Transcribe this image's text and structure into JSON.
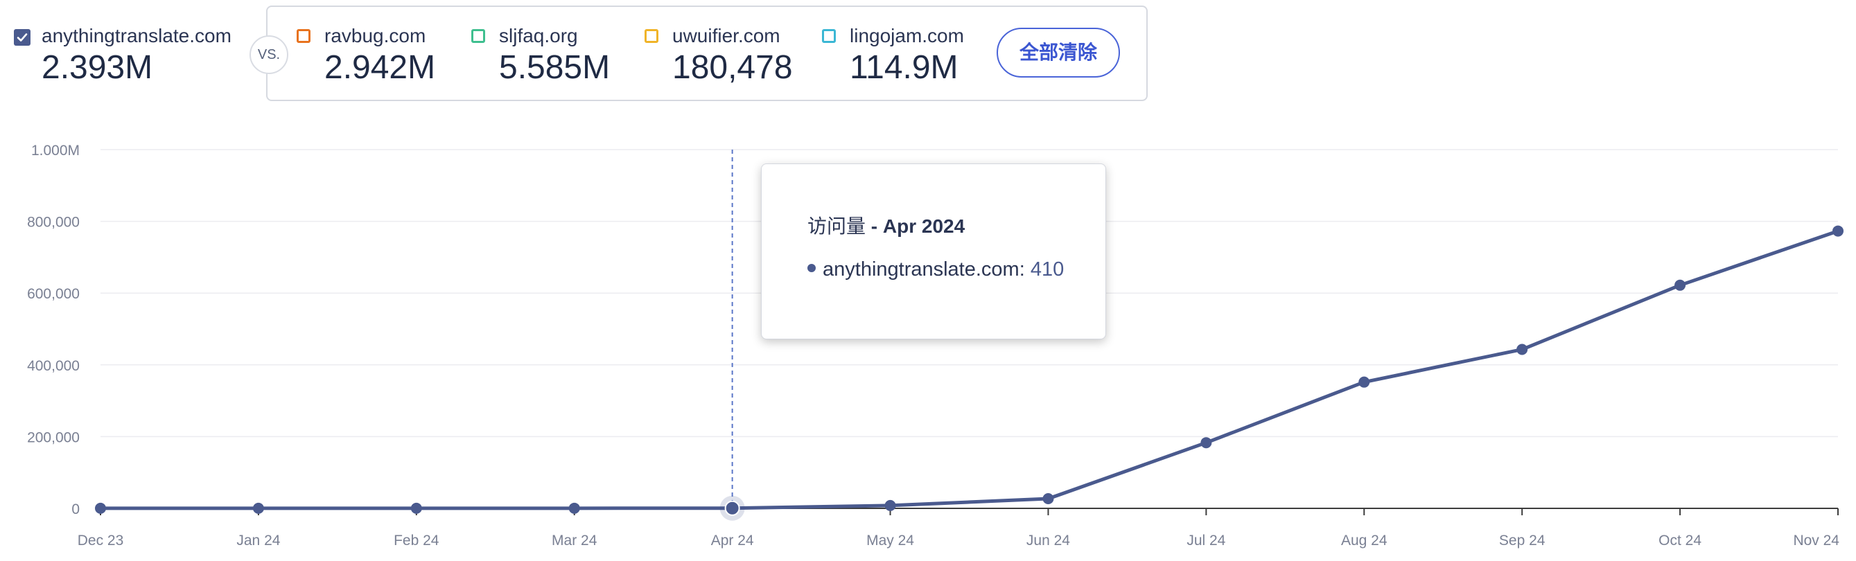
{
  "primary": {
    "domain": "anythingtranslate.com",
    "value": "2.393M",
    "checked": true
  },
  "vs_label": "VS.",
  "competitors": [
    {
      "domain": "ravbug.com",
      "value": "2.942M",
      "color": "#e8731f"
    },
    {
      "domain": "sljfaq.org",
      "value": "5.585M",
      "color": "#3fbf8f"
    },
    {
      "domain": "uwuifier.com",
      "value": "180,478",
      "color": "#f0b429"
    },
    {
      "domain": "lingojam.com",
      "value": "114.9M",
      "color": "#3bb7d4"
    }
  ],
  "clear_all_label": "全部清除",
  "tooltip": {
    "title_prefix": "访问量",
    "title_sep": " - ",
    "title_period": "Apr 2024",
    "series_label": "anythingtranslate.com",
    "value": "410"
  },
  "chart_data": {
    "type": "line",
    "x": [
      "Dec 23",
      "Jan 24",
      "Feb 24",
      "Mar 24",
      "Apr 24",
      "May 24",
      "Jun 24",
      "Jul 24",
      "Aug 24",
      "Sep 24",
      "Oct 24",
      "Nov 24"
    ],
    "series": [
      {
        "name": "anythingtranslate.com",
        "color": "#4a5a8e",
        "values": [
          200,
          300,
          300,
          350,
          410,
          8000,
          27000,
          183000,
          352000,
          443000,
          622000,
          773000
        ]
      }
    ],
    "ylim": [
      0,
      1000000
    ],
    "yticks": [
      0,
      200000,
      400000,
      600000,
      800000,
      1000000
    ],
    "ytick_labels": [
      "0",
      "200,000",
      "400,000",
      "600,000",
      "800,000",
      "1.000M"
    ],
    "grid": true,
    "highlight_index": 4,
    "title": "",
    "xlabel": "",
    "ylabel": ""
  }
}
